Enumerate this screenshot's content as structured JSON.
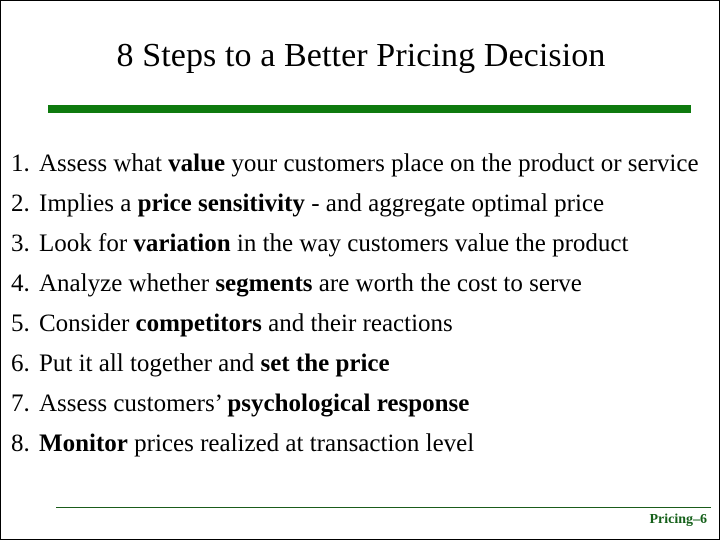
{
  "slide": {
    "title": "8 Steps to a Better Pricing Decision",
    "accent_color": "#0e7a0e",
    "footer_line_color": "#1a5c1a",
    "footer_text_color": "#15601a",
    "background_color": "#ffffff",
    "text_color": "#000000"
  },
  "body": {
    "items": [
      {
        "number": "1.",
        "text_before": "Assess what ",
        "emphasis": "value",
        "text_after": " your customers place on the product or service",
        "full_text": "Assess what value your customers place on the product or service"
      },
      {
        "number": "2.",
        "text_before": "Implies a ",
        "emphasis": "price sensitivity",
        "text_after": " - and aggregate optimal price",
        "full_text": "Implies a price sensitivity - and aggregate optimal price"
      },
      {
        "number": "3.",
        "text_before": "Look for ",
        "emphasis": "variation",
        "text_after": " in the way customers value the product",
        "full_text": "Look for variation in the way customers value the product"
      },
      {
        "number": "4.",
        "text_before": "Analyze whether ",
        "emphasis": "segments",
        "text_after": " are worth the cost to serve",
        "full_text": "Analyze whether segments are worth the cost to serve"
      },
      {
        "number": "5.",
        "text_before": "Consider ",
        "emphasis": "competitors",
        "text_after": " and their reactions",
        "full_text": "Consider competitors and their reactions"
      },
      {
        "number": "6.",
        "text_before": "Put it all together and ",
        "emphasis": "set the price",
        "text_after": "",
        "full_text": "Put it all together and set the price"
      },
      {
        "number": "7.",
        "text_before": "Assess customers’ ",
        "emphasis": "psychological response",
        "text_after": "",
        "full_text": "Assess customers’ psychological response"
      },
      {
        "number": "8.",
        "text_before": "",
        "emphasis": "Monitor",
        "text_after": " prices realized at transaction level",
        "full_text": "Monitor prices realized at transaction level"
      }
    ]
  },
  "footer": {
    "label": "Pricing–6"
  }
}
